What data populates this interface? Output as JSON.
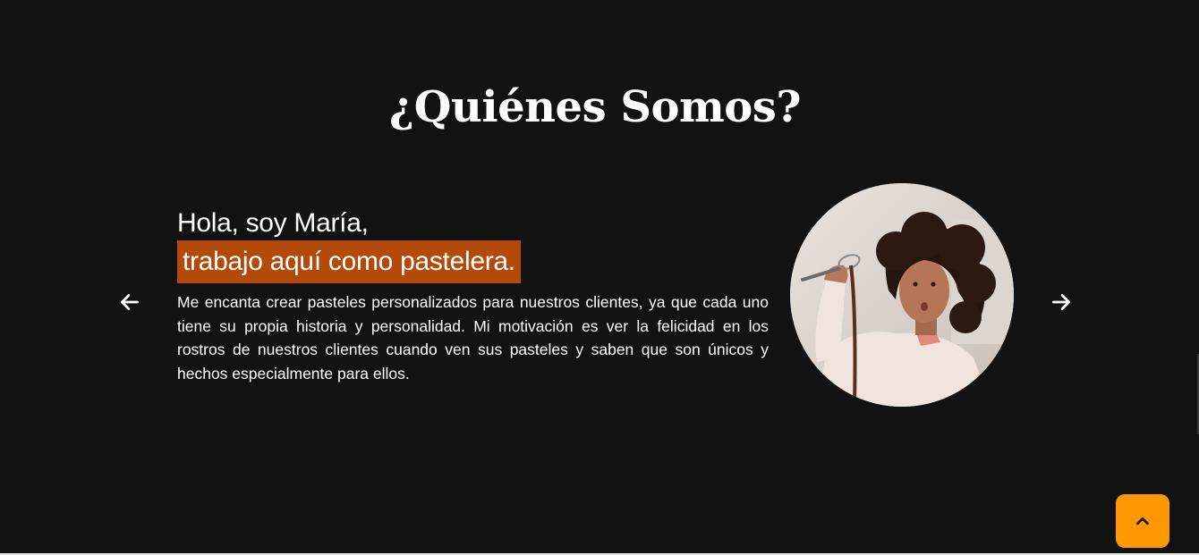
{
  "about": {
    "title": "¿Quiénes Somos?",
    "slide": {
      "greeting": "Hola, soy María,",
      "role": "trabajo aquí como pastelera.",
      "bio": "Me encanta crear pasteles personalizados para nuestros clientes, ya que cada uno tiene su propia historia y personalidad. Mi motivación es ver la felicidad en los rostros de nuestros clientes cuando ven sus pasteles y saben que son únicos y hechos especialmente para ellos."
    }
  },
  "icons": {
    "prev": "arrow-left-icon",
    "next": "arrow-right-icon",
    "to_top": "chevron-up-icon"
  },
  "colors": {
    "background": "#121212",
    "highlight": "#b34a0a",
    "to_top_button": "#ff9800"
  }
}
